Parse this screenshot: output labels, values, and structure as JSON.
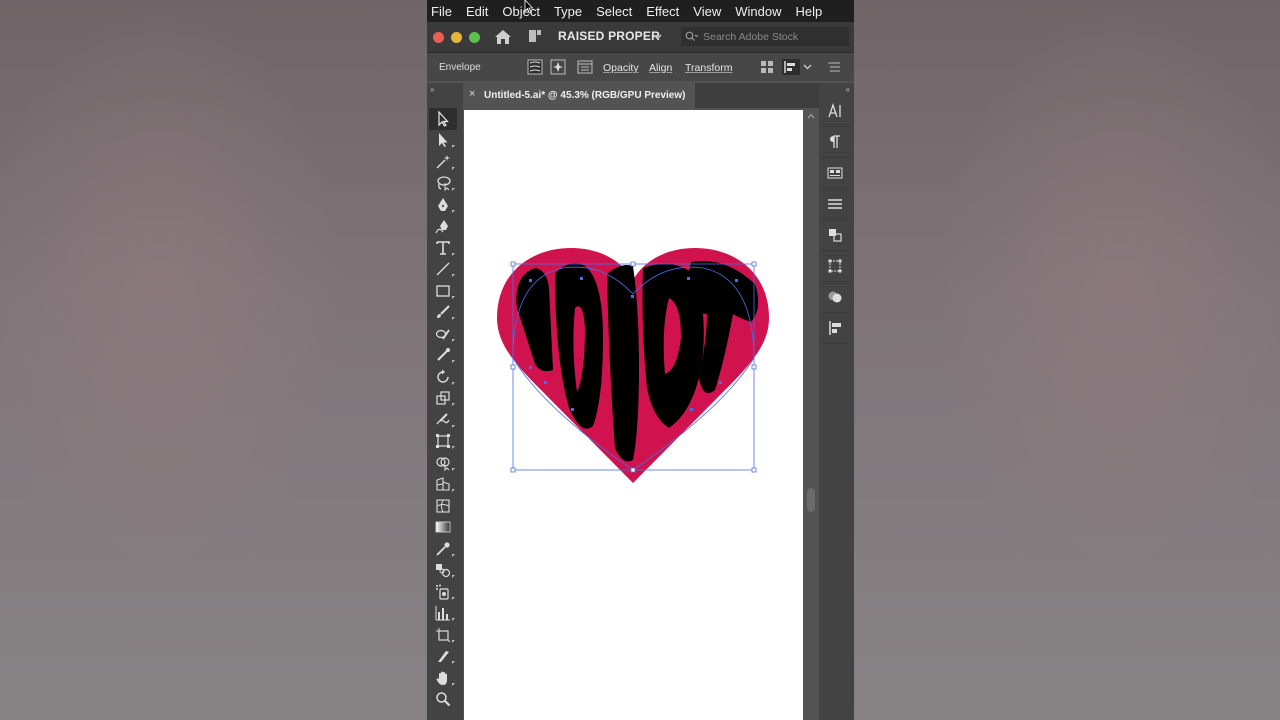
{
  "menu": [
    "File",
    "Edit",
    "Object",
    "Type",
    "Select",
    "Effect",
    "View",
    "Window",
    "Help"
  ],
  "titlebar": {
    "workspace": "RAISED PROPER",
    "search_placeholder": "Search Adobe Stock"
  },
  "control_bar": {
    "label": "Envelope",
    "opacity": "Opacity",
    "align": "Align",
    "transform": "Transform"
  },
  "document_tab": {
    "close": "×",
    "title": "Untitled-5.ai* @ 45.3% (RGB/GPU Preview)"
  },
  "artwork": {
    "text": "IDIOT",
    "heart_color": "#d0134f",
    "text_color": "#000000",
    "selection_color": "#4b6fe0"
  },
  "tools": [
    "selection-tool",
    "direct-selection-tool",
    "magic-wand-tool",
    "lasso-tool",
    "pen-tool",
    "curvature-tool",
    "type-tool",
    "line-segment-tool",
    "rectangle-tool",
    "paintbrush-tool",
    "shaper-tool",
    "pencil-tool",
    "rotate-tool",
    "scale-tool",
    "warp-tool",
    "free-transform-tool",
    "shape-builder-tool",
    "perspective-grid-tool",
    "mesh-tool",
    "gradient-tool",
    "eyedropper-tool",
    "blend-tool",
    "symbol-sprayer-tool",
    "column-graph-tool",
    "artboard-tool",
    "slice-tool",
    "hand-tool",
    "zoom-tool"
  ],
  "right_panels": [
    "character-panel",
    "paragraph-panel",
    "properties-panel",
    "layers-panel",
    "libraries-panel",
    "transform-panel",
    "appearance-panel",
    "align-panel"
  ]
}
